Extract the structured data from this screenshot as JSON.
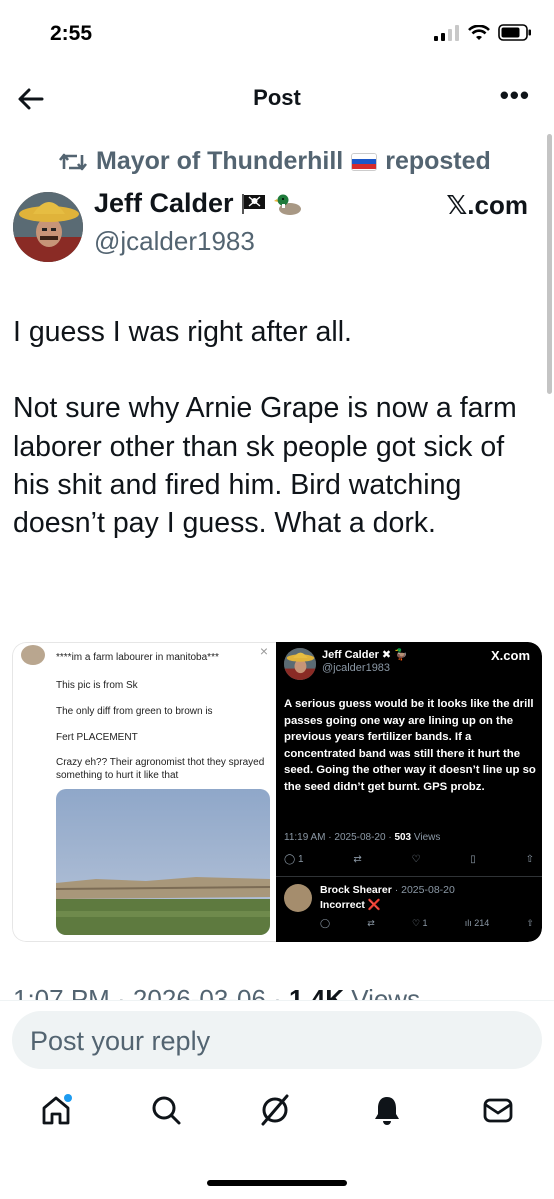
{
  "status_bar": {
    "time": "2:55"
  },
  "nav": {
    "title": "Post"
  },
  "repost": {
    "reposter": "Mayor of Thunderhill",
    "suffix": "reposted"
  },
  "author": {
    "name": "Jeff Calder",
    "handle": "@jcalder1983",
    "source": "𝕏.com"
  },
  "post": {
    "text": "I guess I was right after all.\n\nNot sure why Arnie Grape is now a farm laborer other than sk people got sick of his shit and fired him. Bird watching doesn’t pay I guess. What a dork."
  },
  "media_left": {
    "line1": "****im a farm labourer in manitoba***",
    "line2": "This pic is from Sk",
    "line3": "The only diff from green to brown is",
    "line4": "Fert PLACEMENT",
    "line5": "Crazy eh?? Their agronomist thot they sprayed something to hurt it like that"
  },
  "media_right": {
    "name": "Jeff Calder",
    "handle": "@jcalder1983",
    "source": "X.com",
    "body": "A serious guess would be it looks like the drill passes going one way are lining up on the previous years fertilizer bands. If a concentrated band was still there it hurt the seed.  Going the other way it doesn’t line up so the seed didn’t get burnt. GPS probz.",
    "meta": "11:19 AM · 2025-08-20 · ",
    "views": "503",
    "views_label": " Views",
    "replies_count": "1",
    "reply_name": "Brock Shearer",
    "reply_date": " · 2025-08-20",
    "reply_text": "Incorrect ❌",
    "reply_likes": "1",
    "reply_views": "214"
  },
  "post_meta": {
    "timestamp": "1:07 PM · 2026-03-06 · ",
    "views": "1.4K",
    "views_label": " Views"
  },
  "reply": {
    "placeholder": "Post your reply"
  },
  "colors": {
    "accent": "#1d9bf0",
    "muted": "#536471",
    "text": "#0f1419"
  },
  "icons": [
    "back-arrow-icon",
    "more-icon",
    "repost-icon",
    "home-icon",
    "search-icon",
    "grok-icon",
    "notifications-icon",
    "messages-icon"
  ]
}
